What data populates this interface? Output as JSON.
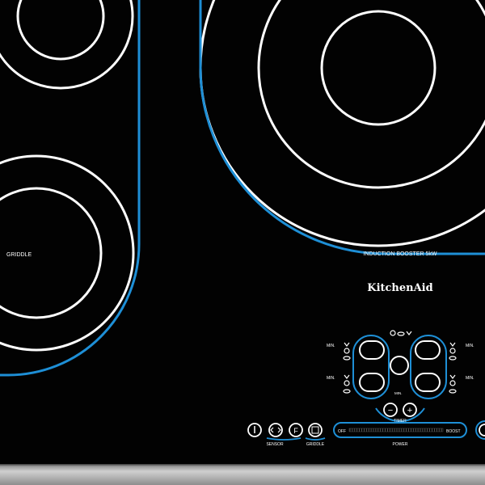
{
  "zones": {
    "griddle_label": "GRIDDLE",
    "booster_label": "INDUCTION BOOSTER 5kW"
  },
  "brand": {
    "logo_text": "KitchenAid"
  },
  "controls": {
    "min_left_top": "MIN.",
    "min_left_bottom": "MIN.",
    "min_right_top": "MIN.",
    "min_right_bottom": "MIN.",
    "min_center": "MIN.",
    "timer_label": "TIMER",
    "timer_minus": "−",
    "timer_plus": "+",
    "sensor_label": "SENSOR",
    "griddle_button_label": "GRIDDLE",
    "power_off": "OFF",
    "power_boost": "BOOST",
    "power_label": "POWER",
    "power_slider_level": 0,
    "temp_unit_symbol": "F"
  },
  "icons": {
    "on_off": "power-icon",
    "sensor": "sensor-icon",
    "temperature": "fahrenheit-icon",
    "griddle": "griddle-icon",
    "pot": "pot-icon",
    "pan": "pan-icon",
    "melt": "melt-icon",
    "bridge": "bridge-icon"
  },
  "colors": {
    "glass": "#020202",
    "ring": "#ffffff",
    "accent": "#1e8fd6",
    "trim": "#bdbdbd"
  }
}
